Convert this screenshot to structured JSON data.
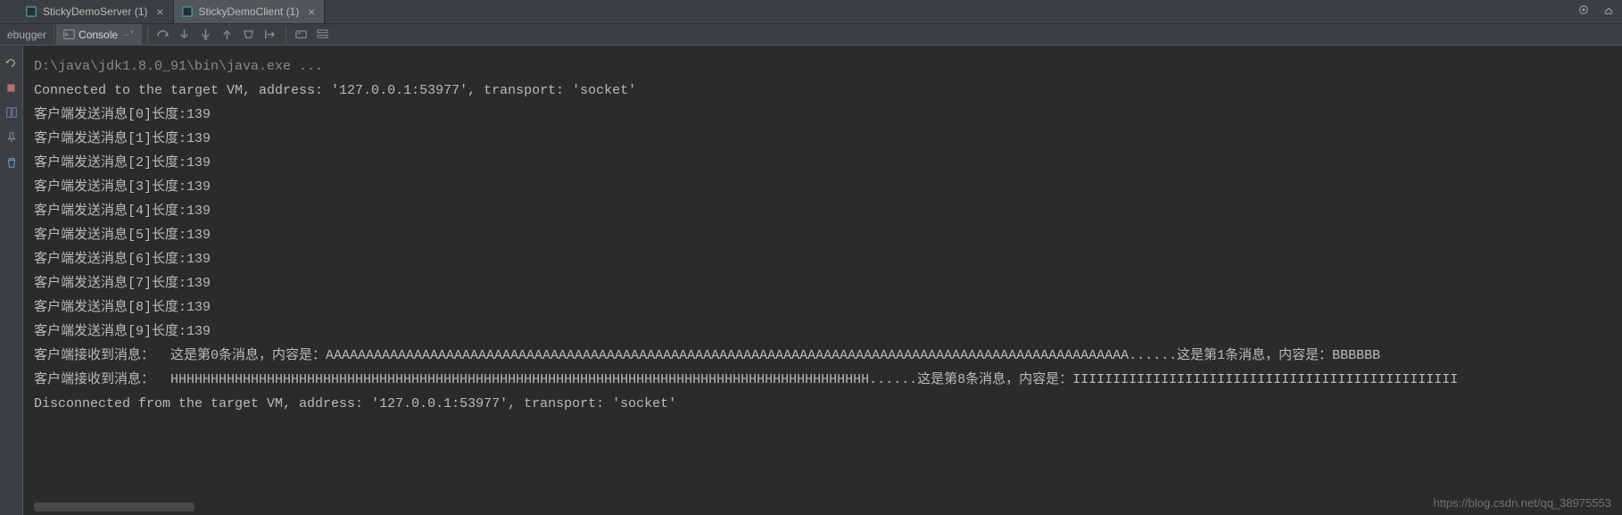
{
  "tabs": [
    {
      "label": "StickyDemoServer (1)",
      "active": false
    },
    {
      "label": "StickyDemoClient (1)",
      "active": true
    }
  ],
  "toolbar": {
    "debugger_label": "ebugger",
    "console_label": "Console"
  },
  "console": {
    "cmd": "D:\\java\\jdk1.8.0_91\\bin\\java.exe ...",
    "lines": [
      "Connected to the target VM, address: '127.0.0.1:53977', transport: 'socket'",
      "客户端发送消息[0]长度:139",
      "客户端发送消息[1]长度:139",
      "客户端发送消息[2]长度:139",
      "客户端发送消息[3]长度:139",
      "客户端发送消息[4]长度:139",
      "客户端发送消息[5]长度:139",
      "客户端发送消息[6]长度:139",
      "客户端发送消息[7]长度:139",
      "客户端发送消息[8]长度:139",
      "客户端发送消息[9]长度:139",
      "客户端接收到消息：  这是第0条消息，内容是：AAAAAAAAAAAAAAAAAAAAAAAAAAAAAAAAAAAAAAAAAAAAAAAAAAAAAAAAAAAAAAAAAAAAAAAAAAAAAAAAAAAAAAAAAAAAAAAAAAAA......这是第1条消息，内容是：BBBBBB",
      "客户端接收到消息：  HHHHHHHHHHHHHHHHHHHHHHHHHHHHHHHHHHHHHHHHHHHHHHHHHHHHHHHHHHHHHHHHHHHHHHHHHHHHHHHHHHHHHHH......这是第8条消息，内容是：IIIIIIIIIIIIIIIIIIIIIIIIIIIIIIIIIIIIIIIIIIIIIIII",
      "Disconnected from the target VM, address: '127.0.0.1:53977', transport: 'socket'"
    ]
  },
  "watermark": "https://blog.csdn.net/qq_38975553"
}
